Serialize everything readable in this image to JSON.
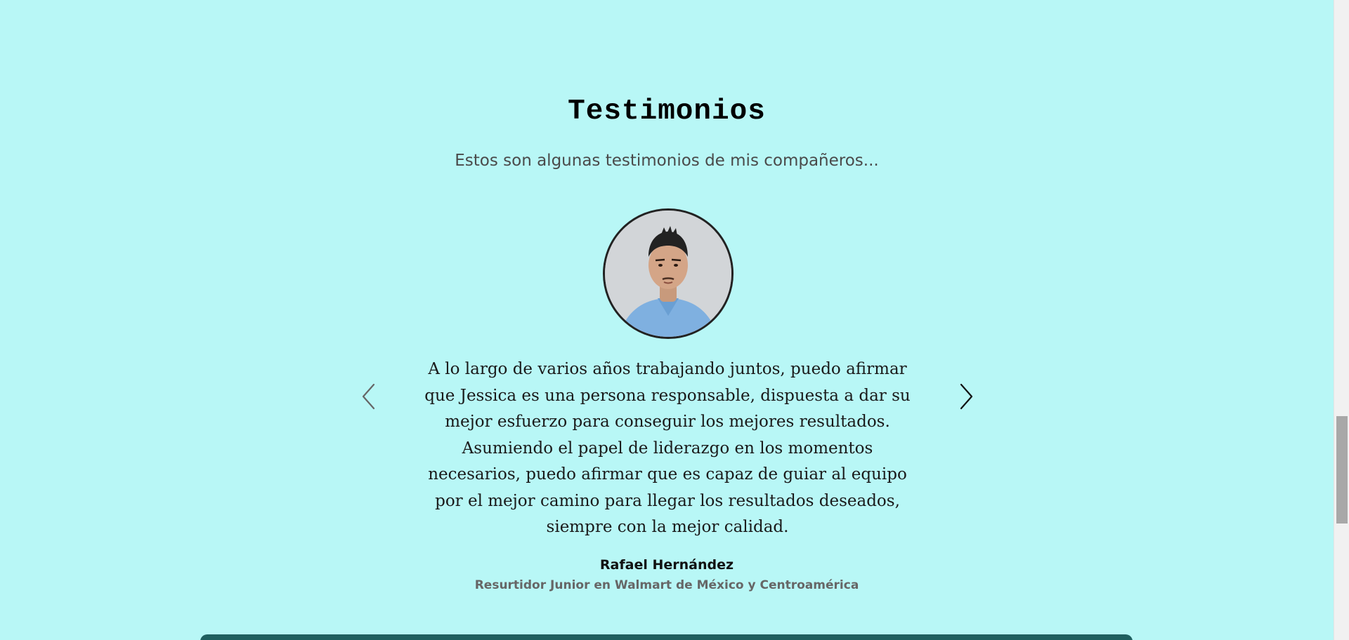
{
  "section": {
    "title": "Testimonios",
    "subtitle": "Estos son algunas testimonios de mis compañeros..."
  },
  "testimonial": {
    "avatar_icon": "person-photo",
    "quote": "A lo largo de varios años trabajando juntos, puedo afirmar que Jessica es una persona responsable, dispuesta a dar su mejor esfuerzo para conseguir los mejores resultados. Asumiendo el papel de liderazgo en los momentos necesarios, puedo afirmar que es capaz de guiar al equipo por el mejor camino para llegar los resultados deseados, siempre con la mejor calidad.",
    "author": "Rafael Hernández",
    "role": "Resurtidor Junior en Walmart de México y Centroamérica"
  },
  "carousel": {
    "prev_icon": "chevron-left-icon",
    "next_icon": "chevron-right-icon"
  },
  "colors": {
    "background": "#b8f7f6",
    "footer_strip": "#1f5f5f"
  }
}
